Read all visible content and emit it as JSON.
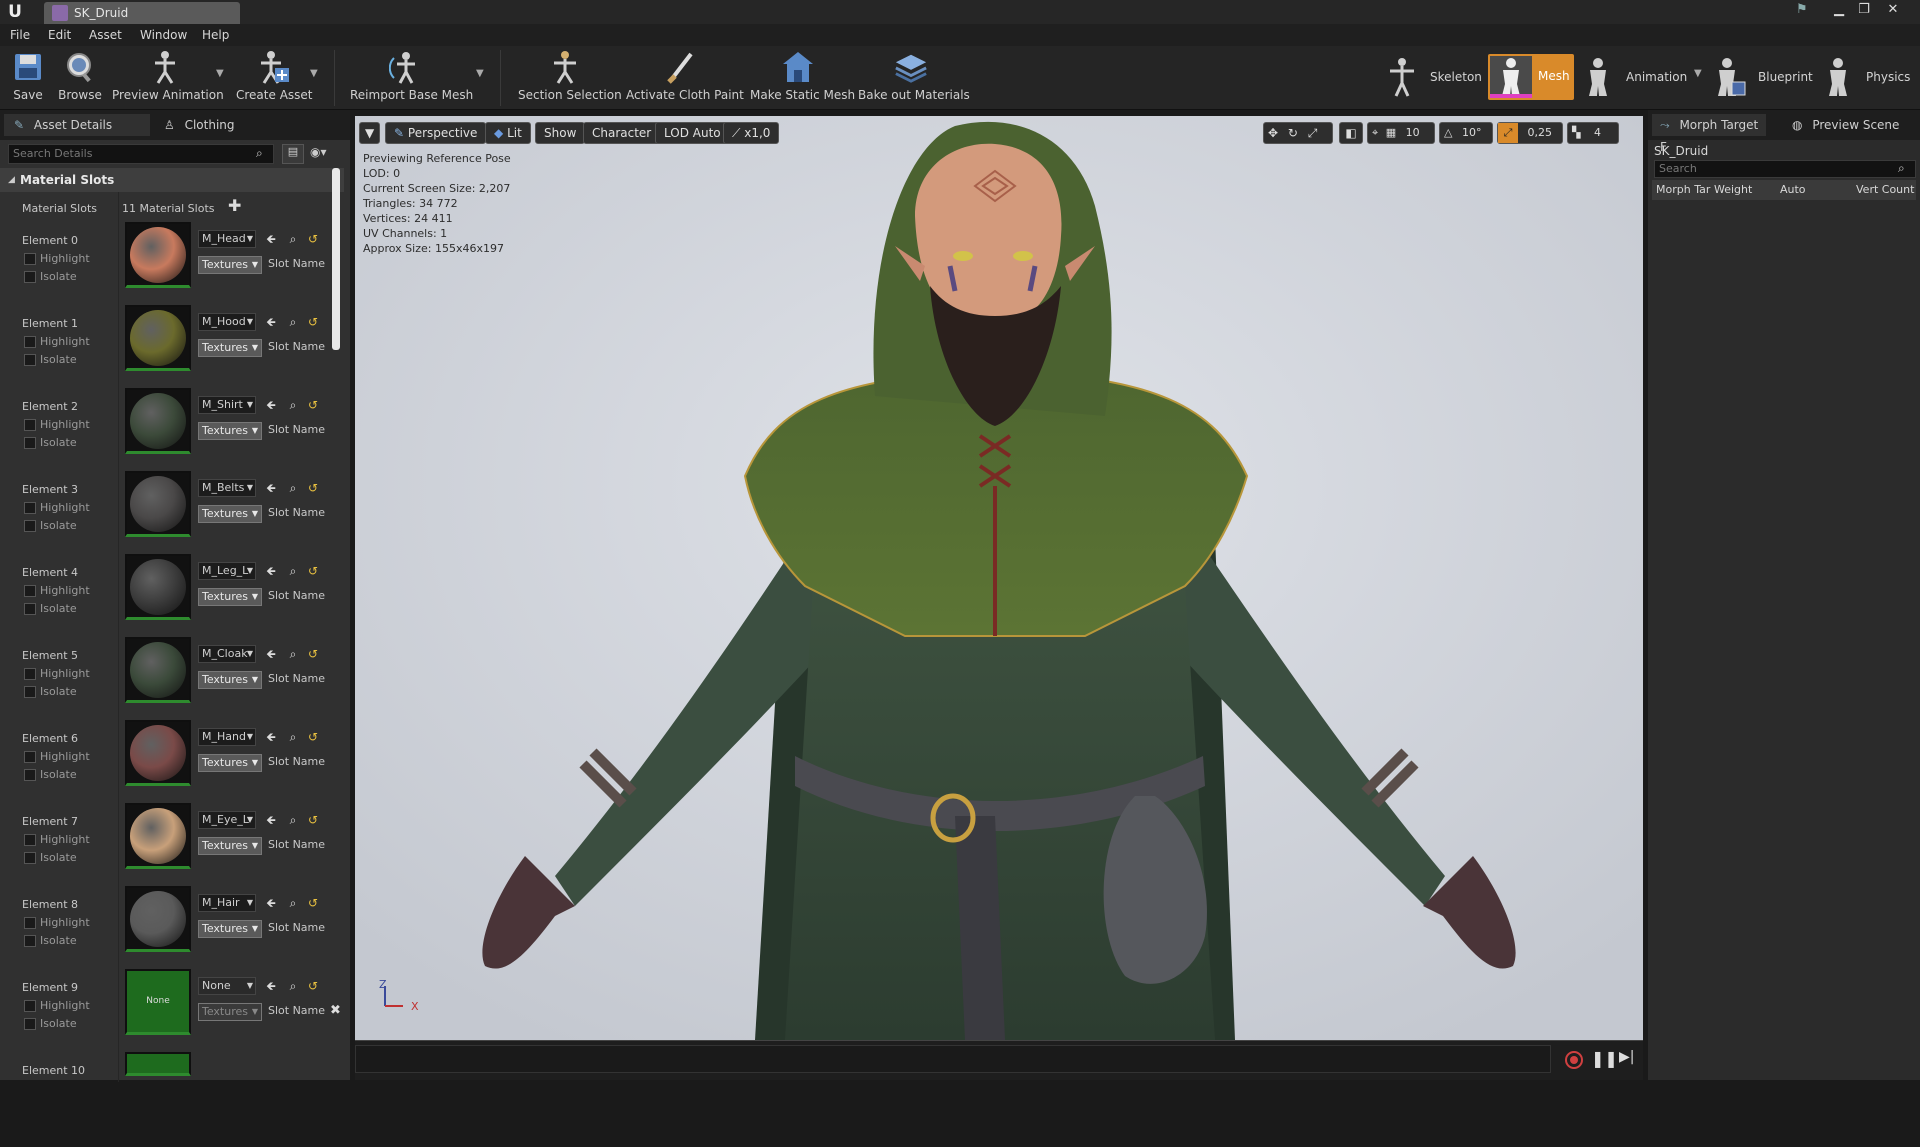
{
  "window": {
    "tab_title": "SK_Druid",
    "min_icon": "minimize-icon",
    "max_icon": "maximize-icon",
    "close_icon": "close-icon"
  },
  "menu": [
    "File",
    "Edit",
    "Asset",
    "Window",
    "Help"
  ],
  "toolbar": {
    "buttons": [
      {
        "label": "Save",
        "icon": "save-icon"
      },
      {
        "label": "Browse",
        "icon": "browse-icon"
      },
      {
        "label": "Preview Animation",
        "icon": "preview-animation-icon"
      },
      {
        "label": "Create Asset",
        "icon": "create-asset-icon"
      },
      {
        "label": "Reimport Base Mesh",
        "icon": "reimport-icon"
      },
      {
        "label": "Section Selection",
        "icon": "section-selection-icon"
      },
      {
        "label": "Activate Cloth Paint",
        "icon": "cloth-paint-icon"
      },
      {
        "label": "Make Static Mesh",
        "icon": "static-mesh-icon"
      },
      {
        "label": "Bake out Materials",
        "icon": "bake-materials-icon"
      }
    ],
    "modes": [
      {
        "label": "Skeleton",
        "active": false
      },
      {
        "label": "Mesh",
        "active": true
      },
      {
        "label": "Animation",
        "active": false
      },
      {
        "label": "Blueprint",
        "active": false
      },
      {
        "label": "Physics",
        "active": false
      }
    ]
  },
  "left_panel": {
    "tabs": [
      "Asset Details",
      "Clothing"
    ],
    "search_placeholder": "Search Details",
    "section_title": "Material Slots",
    "material_slots_label": "Material Slots",
    "material_slots_count": "11 Material Slots",
    "highlight_label": "Highlight",
    "isolate_label": "Isolate",
    "textures_label": "Textures",
    "slot_name_label": "Slot Name",
    "elements": [
      {
        "label": "Element 0",
        "material": "M_Head",
        "color": "#c87a5e"
      },
      {
        "label": "Element 1",
        "material": "M_Hood",
        "color": "#6b6a2c"
      },
      {
        "label": "Element 2",
        "material": "M_Shirt",
        "color": "#3c4a3a"
      },
      {
        "label": "Element 3",
        "material": "M_Belts",
        "color": "#4a4848"
      },
      {
        "label": "Element 4",
        "material": "M_Leg_L",
        "color": "#3e3e3e"
      },
      {
        "label": "Element 5",
        "material": "M_Cloak",
        "color": "#3b4a3a"
      },
      {
        "label": "Element 6",
        "material": "M_Hand",
        "color": "#7a4a48"
      },
      {
        "label": "Element 7",
        "material": "M_Eye_L",
        "color": "#c8a07a"
      },
      {
        "label": "Element 8",
        "material": "M_Hair",
        "color": "#5a5a5a"
      },
      {
        "label": "Element 9",
        "material": "None",
        "color": "#1e6b1e"
      },
      {
        "label": "Element 10",
        "material": "",
        "color": "#1e6b1e"
      }
    ]
  },
  "viewport": {
    "perspective": "Perspective",
    "lit": "Lit",
    "show": "Show",
    "character": "Character",
    "lod": "LOD Auto",
    "speed": "x1,0",
    "grid_snap": "10",
    "rot_snap": "10°",
    "scale_snap": "0,25",
    "cam_speed": "4",
    "stats": [
      "Previewing Reference Pose",
      "LOD: 0",
      "Current Screen Size: 2,207",
      "Triangles: 34 772",
      "Vertices: 24 411",
      "UV Channels: 1",
      "Approx Size: 155x46x197"
    ],
    "axis_z": "Z",
    "axis_x": "X"
  },
  "right_panel": {
    "tabs": [
      "Morph Target F",
      "Preview Scene"
    ],
    "asset_name": "SK_Druid",
    "search_placeholder": "Search",
    "columns": [
      "Morph Tar",
      "Weight",
      "Auto",
      "Vert Count"
    ]
  },
  "colors": {
    "accent_mesh": "#d98a2a",
    "asset_tab_icon": "#8a6aa8",
    "slot_border": "#2e8b2e"
  }
}
